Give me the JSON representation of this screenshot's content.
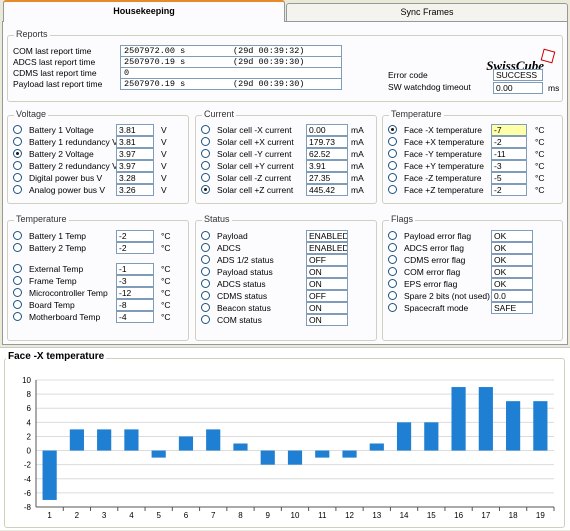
{
  "tabs": [
    {
      "label": "Housekeeping",
      "active": true
    },
    {
      "label": "Sync Frames",
      "active": false
    }
  ],
  "reports": {
    "title": "Reports",
    "rows": [
      {
        "label": "COM last report time",
        "value": "2507972.00 s",
        "time": "(29d 00:39:32)"
      },
      {
        "label": "ADCS last report time",
        "value": "2507970.19 s",
        "time": "(29d 00:39:30)"
      },
      {
        "label": "CDMS last report time",
        "value": "0",
        "time": ""
      },
      {
        "label": "Payload last report time",
        "value": "2507970.19 s",
        "time": "(29d 00:39:30)"
      }
    ],
    "logo": "SwissCube",
    "error_code_label": "Error code",
    "error_code_value": "SUCCESS",
    "watchdog_label": "SW watchdog timeout",
    "watchdog_value": "0.00",
    "watchdog_unit": "ms"
  },
  "voltage": {
    "title": "Voltage",
    "items": [
      {
        "label": "Battery 1 Voltage",
        "value": "3.81",
        "unit": "V",
        "selected": false
      },
      {
        "label": "Battery 1 redundancy V",
        "value": "3.81",
        "unit": "V",
        "selected": false
      },
      {
        "label": "Battery 2 Voltage",
        "value": "3.97",
        "unit": "V",
        "selected": true
      },
      {
        "label": "Battery 2 redundancy V",
        "value": "3.97",
        "unit": "V",
        "selected": false
      },
      {
        "label": "Digital power bus V",
        "value": "3.28",
        "unit": "V",
        "selected": false
      },
      {
        "label": "Analog power bus V",
        "value": "3.26",
        "unit": "V",
        "selected": false
      }
    ]
  },
  "current": {
    "title": "Current",
    "items": [
      {
        "label": "Solar cell -X current",
        "value": "0.00",
        "unit": "mA",
        "selected": false
      },
      {
        "label": "Solar cell +X current",
        "value": "179.73",
        "unit": "mA",
        "selected": false
      },
      {
        "label": "Solar cell -Y current",
        "value": "62.52",
        "unit": "mA",
        "selected": false
      },
      {
        "label": "Solar cell +Y current",
        "value": "3.91",
        "unit": "mA",
        "selected": false
      },
      {
        "label": "Solar cell -Z current",
        "value": "27.35",
        "unit": "mA",
        "selected": false
      },
      {
        "label": "Solar cell +Z current",
        "value": "445.42",
        "unit": "mA",
        "selected": true
      }
    ]
  },
  "temperature_faces": {
    "title": "Temperature",
    "items": [
      {
        "label": "Face -X temperature",
        "value": "-7",
        "unit": "°C",
        "selected": true,
        "highlight": true
      },
      {
        "label": "Face +X temperature",
        "value": "-2",
        "unit": "°C",
        "selected": false
      },
      {
        "label": "Face -Y temperature",
        "value": "-11",
        "unit": "°C",
        "selected": false
      },
      {
        "label": "Face +Y temperature",
        "value": "-3",
        "unit": "°C",
        "selected": false
      },
      {
        "label": "Face -Z temperature",
        "value": "-5",
        "unit": "°C",
        "selected": false
      },
      {
        "label": "Face +Z temperature",
        "value": "-2",
        "unit": "°C",
        "selected": false
      }
    ]
  },
  "temperature_internal": {
    "title": "Temperature",
    "items": [
      {
        "label": "Battery 1 Temp",
        "value": "-2",
        "unit": "°C",
        "selected": false
      },
      {
        "label": "Battery 2 Temp",
        "value": "-2",
        "unit": "°C",
        "selected": false
      },
      {
        "label": "External Temp",
        "value": "-1",
        "unit": "°C",
        "selected": false
      },
      {
        "label": "Frame  Temp",
        "value": "-3",
        "unit": "°C",
        "selected": false
      },
      {
        "label": "Microcontroller Temp",
        "value": "-12",
        "unit": "°C",
        "selected": false
      },
      {
        "label": "Board Temp",
        "value": "-8",
        "unit": "°C",
        "selected": false
      },
      {
        "label": "Motherboard Temp",
        "value": "-4",
        "unit": "°C",
        "selected": false
      }
    ]
  },
  "status": {
    "title": "Status",
    "items": [
      {
        "label": "Payload",
        "value": "ENABLED",
        "selected": false
      },
      {
        "label": "ADCS",
        "value": "ENABLED",
        "selected": false
      },
      {
        "label": "ADS 1/2 status",
        "value": "OFF",
        "selected": false
      },
      {
        "label": "Payload status",
        "value": "ON",
        "selected": false
      },
      {
        "label": "ADCS status",
        "value": "ON",
        "selected": false
      },
      {
        "label": "CDMS status",
        "value": "OFF",
        "selected": false
      },
      {
        "label": "Beacon status",
        "value": "ON",
        "selected": false
      },
      {
        "label": "COM status",
        "value": "ON",
        "selected": false
      }
    ]
  },
  "flags": {
    "title": "Flags",
    "items": [
      {
        "label": "Payload error flag",
        "value": "OK",
        "selected": false
      },
      {
        "label": "ADCS error flag",
        "value": "OK",
        "selected": false
      },
      {
        "label": "CDMS error flag",
        "value": "OK",
        "selected": false
      },
      {
        "label": "COM error flag",
        "value": "OK",
        "selected": false
      },
      {
        "label": "EPS error flag",
        "value": "OK",
        "selected": false
      },
      {
        "label": "Spare 2 bits (not used)",
        "value": "0.0",
        "selected": false
      },
      {
        "label": "Spacecraft mode",
        "value": "SAFE",
        "selected": false
      }
    ]
  },
  "chart_data": {
    "type": "bar",
    "title": "Face -X temperature",
    "categories": [
      "1",
      "2",
      "3",
      "4",
      "5",
      "6",
      "7",
      "8",
      "9",
      "10",
      "11",
      "12",
      "13",
      "14",
      "15",
      "16",
      "17",
      "18",
      "19"
    ],
    "values": [
      -7,
      3,
      3,
      3,
      -1,
      2,
      3,
      1,
      -2,
      -2,
      -1,
      -1,
      1,
      4,
      4,
      9,
      9,
      7,
      7
    ],
    "ylim": [
      -8,
      10
    ],
    "yticks": [
      10,
      8,
      6,
      4,
      2,
      0,
      -2,
      -4,
      -6,
      -8
    ],
    "grid": true,
    "bar_color": "#1f7fd2"
  }
}
